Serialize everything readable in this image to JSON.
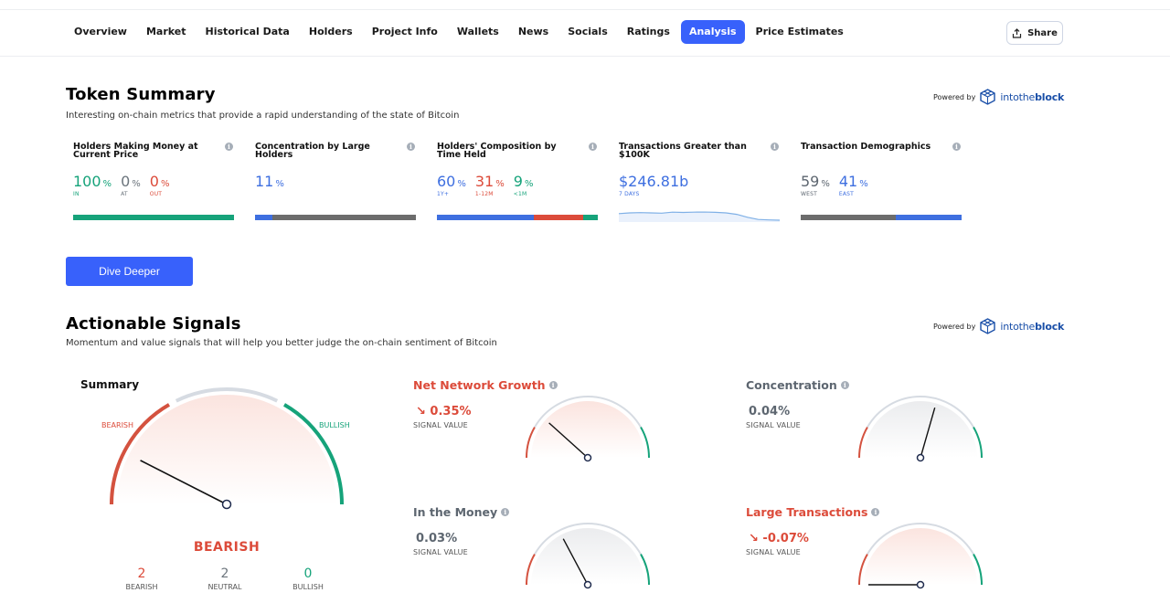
{
  "nav": {
    "tabs": [
      {
        "label": "Overview"
      },
      {
        "label": "Market"
      },
      {
        "label": "Historical Data"
      },
      {
        "label": "Holders"
      },
      {
        "label": "Project Info"
      },
      {
        "label": "Wallets"
      },
      {
        "label": "News"
      },
      {
        "label": "Socials"
      },
      {
        "label": "Ratings"
      },
      {
        "label": "Analysis",
        "active": true
      },
      {
        "label": "Price Estimates"
      }
    ],
    "share_label": "Share"
  },
  "token_summary": {
    "title": "Token Summary",
    "subtitle": "Interesting on-chain metrics that provide a rapid understanding of the state of Bitcoin",
    "powered_by": "Powered by",
    "provider": "intotheblock",
    "metrics": [
      {
        "title": "Holders Making Money at Current Price",
        "values": [
          {
            "num": "100",
            "pct": "%",
            "label": "IN",
            "color": "#16a37a"
          },
          {
            "num": "0",
            "pct": "%",
            "label": "AT",
            "color": "#6c757d"
          },
          {
            "num": "0",
            "pct": "%",
            "label": "OUT",
            "color": "#dc4b3a"
          }
        ],
        "bar": [
          {
            "share": 100,
            "color": "#16a37a"
          }
        ]
      },
      {
        "title": "Concentration by Large Holders",
        "values": [
          {
            "num": "11",
            "pct": "%",
            "label": "",
            "color": "#3e6fe0"
          }
        ],
        "bar": [
          {
            "share": 11,
            "color": "#3e6fe0"
          },
          {
            "share": 89,
            "color": "#6c6c6c"
          }
        ]
      },
      {
        "title": "Holders' Composition by Time Held",
        "values": [
          {
            "num": "60",
            "pct": "%",
            "label": "1Y+",
            "color": "#3e6fe0"
          },
          {
            "num": "31",
            "pct": "%",
            "label": "1-12M",
            "color": "#dc4b3a"
          },
          {
            "num": "9",
            "pct": "%",
            "label": "<1M",
            "color": "#16a37a"
          }
        ],
        "bar": [
          {
            "share": 60,
            "color": "#3e6fe0"
          },
          {
            "share": 31,
            "color": "#dc4b3a"
          },
          {
            "share": 9,
            "color": "#16a37a"
          }
        ]
      },
      {
        "title": "Transactions Greater than $100K",
        "values": [
          {
            "num": "$246.81b",
            "pct": "",
            "label": "7 DAYS",
            "color": "#3e6fe0"
          }
        ],
        "sparkline": [
          0.55,
          0.5,
          0.48,
          0.5,
          0.52,
          0.45,
          0.47,
          0.45,
          0.44,
          0.46,
          0.5,
          0.6,
          0.8,
          0.95,
          0.98,
          1.0
        ]
      },
      {
        "title": "Transaction Demographics",
        "values": [
          {
            "num": "59",
            "pct": "%",
            "label": "WEST",
            "color": "#5d6670"
          },
          {
            "num": "41",
            "pct": "%",
            "label": "EAST",
            "color": "#3e6fe0"
          }
        ],
        "bar": [
          {
            "share": 59,
            "color": "#6c6c6c"
          },
          {
            "share": 41,
            "color": "#3e6fe0"
          }
        ]
      }
    ],
    "dive_label": "Dive Deeper"
  },
  "signals": {
    "title": "Actionable Signals",
    "subtitle": "Momentum and value signals that will help you better judge the on-chain sentiment of Bitcoin",
    "powered_by": "Powered by",
    "provider": "intotheblock",
    "summary": {
      "title": "Summary",
      "bearish_label": "BEARISH",
      "bullish_label": "BULLISH",
      "verdict": "BEARISH",
      "needle_angle_deg": 153,
      "counts": [
        {
          "n": "2",
          "label": "BEARISH",
          "color": "#dc4b3a"
        },
        {
          "n": "2",
          "label": "NEUTRAL",
          "color": "#6c757d"
        },
        {
          "n": "0",
          "label": "BULLISH",
          "color": "#16a37a"
        }
      ]
    },
    "cards": [
      {
        "title": "Net Network Growth",
        "value": "↘ 0.35%",
        "caption": "SIGNAL VALUE",
        "color": "#dc4b3a",
        "tint": "red",
        "needle_angle_deg": 138
      },
      {
        "title": "Concentration",
        "value": "0.04%",
        "caption": "SIGNAL VALUE",
        "color": "#5d6670",
        "tint": "grey",
        "needle_angle_deg": 74
      },
      {
        "title": "In the Money",
        "value": "0.03%",
        "caption": "SIGNAL VALUE",
        "color": "#5d6670",
        "tint": "grey",
        "needle_angle_deg": 118
      },
      {
        "title": "Large Transactions",
        "value": "↘ -0.07%",
        "caption": "SIGNAL VALUE",
        "color": "#dc4b3a",
        "tint": "red",
        "needle_angle_deg": 180
      }
    ]
  }
}
